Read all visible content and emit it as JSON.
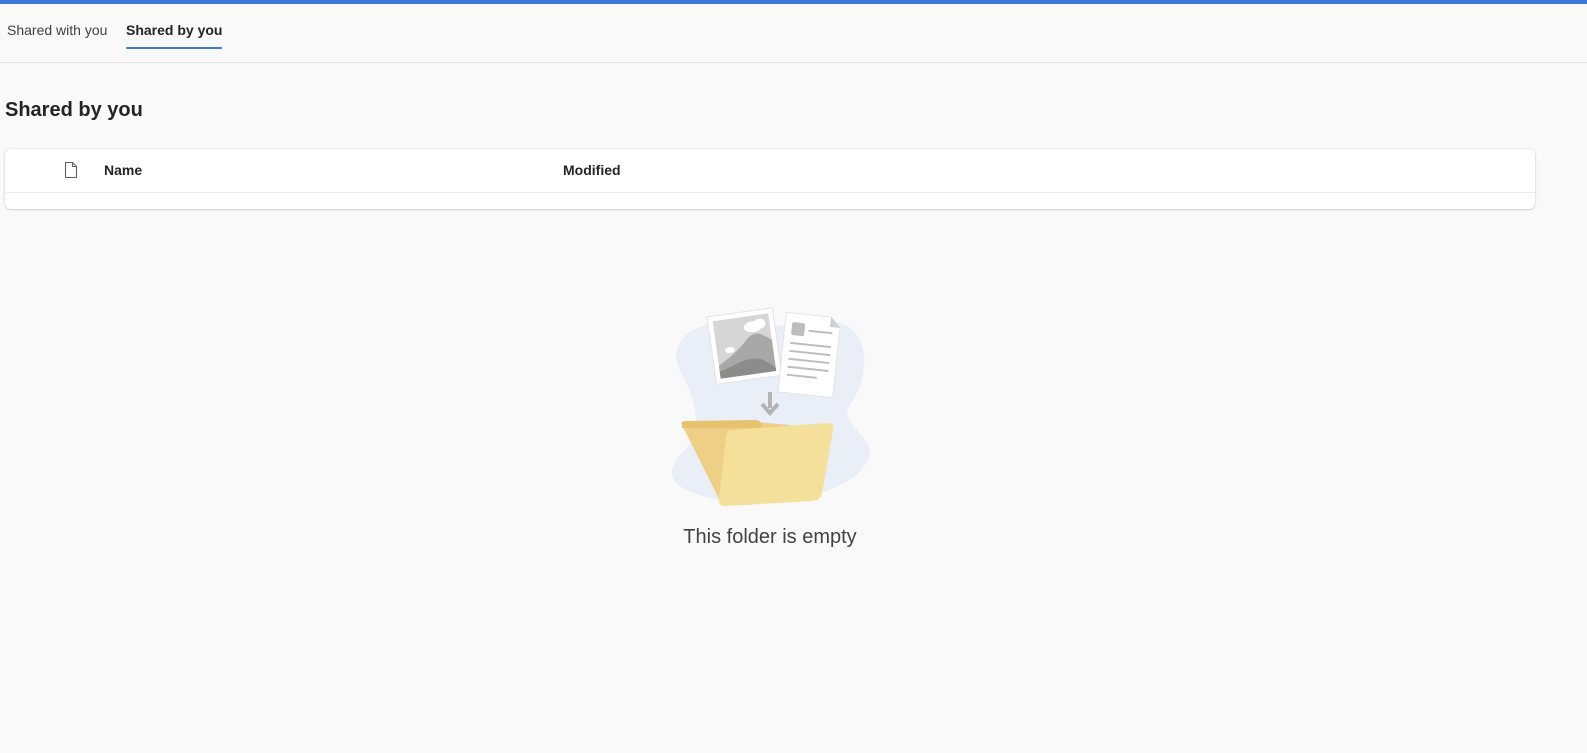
{
  "tabs": [
    {
      "label": "Shared with you",
      "active": false
    },
    {
      "label": "Shared by you",
      "active": true
    }
  ],
  "page": {
    "title": "Shared by you"
  },
  "table": {
    "file_type_icon": "document-icon",
    "columns": [
      "Name",
      "Modified"
    ],
    "rows": []
  },
  "empty_state": {
    "message": "This folder is empty",
    "illustration": "empty-folder-illustration"
  },
  "colors": {
    "accent": "#3c78d8",
    "background": "#f9f9f9",
    "folder": "#f2d98c"
  }
}
